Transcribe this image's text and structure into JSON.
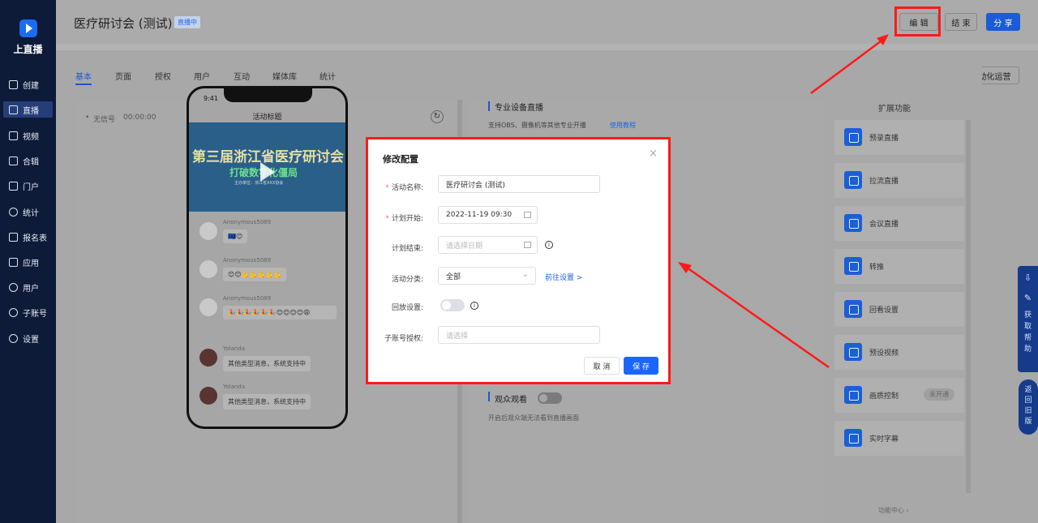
{
  "app": {
    "logo_text": "上直播"
  },
  "sidebar": {
    "items": [
      {
        "label": "创建",
        "icon": "plus-square-icon"
      },
      {
        "label": "直播",
        "icon": "video-camera-icon",
        "active": true
      },
      {
        "label": "视频",
        "icon": "film-icon"
      },
      {
        "label": "合辑",
        "icon": "collection-icon"
      },
      {
        "label": "门户",
        "icon": "monitor-icon"
      },
      {
        "label": "统计",
        "icon": "pie-chart-icon"
      },
      {
        "label": "报名表",
        "icon": "form-icon"
      },
      {
        "label": "应用",
        "icon": "apps-grid-icon"
      },
      {
        "label": "用户",
        "icon": "user-icon"
      },
      {
        "label": "子账号",
        "icon": "sub-account-icon"
      },
      {
        "label": "设置",
        "icon": "gear-icon"
      }
    ]
  },
  "header": {
    "title": "医疗研讨会 (测试)",
    "status": "直播中",
    "edit": "编 辑",
    "end": "结 束",
    "share": "分 享"
  },
  "tabs": [
    "基本",
    "页面",
    "授权",
    "用户",
    "互动",
    "媒体库",
    "统计"
  ],
  "automation": "自动化运营",
  "preview": {
    "signal": "无信号",
    "timer": "00:00:00"
  },
  "phone": {
    "time": "9:41",
    "title": "活动标题",
    "banner_main": "第三届浙江省医疗研讨会",
    "banner_sub": "打破数字化僵局",
    "banner_small": "主办单位：浙江省XXX协会",
    "chats": [
      {
        "name": "Anonymous5089",
        "text": "🇪🇺😊"
      },
      {
        "name": "Anonymous5089",
        "text": "😊😊💪💪💪💪💪"
      },
      {
        "name": "Anonymous5089",
        "text": "🎉🎉🎉🎉🎉🎉😊😊😊😊😩"
      },
      {
        "name": "Yolanda",
        "text": "其他类型消息，系统支持中"
      },
      {
        "name": "Yolanda",
        "text": "其他类型消息，系统支持中"
      }
    ]
  },
  "middle": {
    "section_title": "专业设备直播",
    "desc": "支持OBS、摄像机等其他专业开播",
    "tutorial": "使用教程",
    "audience_title": "观众观看",
    "audience_desc": "开启后观众端无法看到直播画面"
  },
  "extensions": {
    "title": "扩展功能",
    "items": [
      "预录直播",
      "拉流直播",
      "会议直播",
      "转推",
      "回看设置",
      "预设视频",
      "画质控制",
      "实时字幕"
    ],
    "quality_badge": "未开通",
    "center": "功能中心 ›"
  },
  "float": {
    "help": "获取帮助",
    "old": "返回旧版"
  },
  "modal": {
    "title": "修改配置",
    "fields": {
      "name_label": "活动名称:",
      "name_value": "医疗研讨会 (测试)",
      "start_label": "计划开始:",
      "start_value": "2022-11-19 09:30",
      "end_label": "计划结束:",
      "end_placeholder": "请选择日期",
      "category_label": "活动分类:",
      "category_value": "全部",
      "category_link": "前往设置 >",
      "replay_label": "回放设置:",
      "sub_label": "子账号授权:",
      "sub_placeholder": "请选择"
    },
    "cancel": "取 消",
    "save": "保 存"
  },
  "colors": {
    "primary": "#1a66ff",
    "sidebar": "#0d1a38",
    "highlight": "#ff1a1a"
  }
}
